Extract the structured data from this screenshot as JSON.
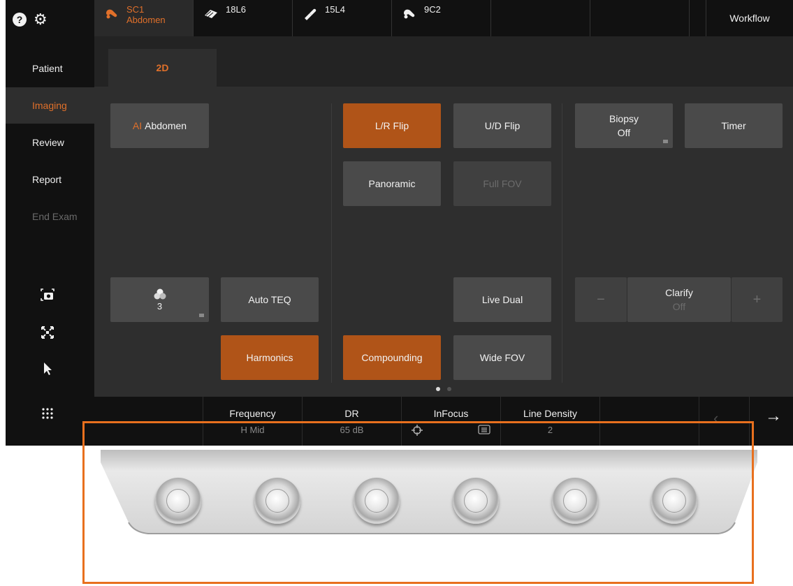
{
  "sidebar": {
    "help_icon": "question-circle-icon",
    "settings_icon": "gear-icon",
    "items": [
      {
        "label": "Patient"
      },
      {
        "label": "Imaging"
      },
      {
        "label": "Review"
      },
      {
        "label": "Report"
      },
      {
        "label": "End Exam"
      }
    ],
    "active_item": "Imaging",
    "tools": [
      "camera-icon",
      "fit-screen-icon",
      "pointer-arrow-icon",
      "grid-menu-icon"
    ]
  },
  "topbar": {
    "probes": [
      {
        "line1": "SC1",
        "line2": "Abdomen"
      },
      {
        "line1": "18L6",
        "line2": ""
      },
      {
        "line1": "15L4",
        "line2": ""
      },
      {
        "line1": "9C2",
        "line2": ""
      }
    ],
    "active_probe": "SC1",
    "workflow_label": "Workflow"
  },
  "tabs": {
    "active": "2D"
  },
  "controls": {
    "ai_prefix": "AI",
    "ai_abdomen": "Abdomen",
    "lr_flip": "L/R Flip",
    "ud_flip": "U/D Flip",
    "biopsy_line1": "Biopsy",
    "biopsy_line2": "Off",
    "timer": "Timer",
    "panoramic": "Panoramic",
    "full_fov": "Full FOV",
    "map_value": "3",
    "auto_teq": "Auto TEQ",
    "live_dual": "Live Dual",
    "clarify_line1": "Clarify",
    "clarify_line2": "Off",
    "minus": "−",
    "plus": "+",
    "harmonics": "Harmonics",
    "compounding": "Compounding",
    "wide_fov": "Wide FOV"
  },
  "states": {
    "lr_flip": "on",
    "harmonics": "on",
    "compounding": "on",
    "full_fov": "disabled",
    "clarify": "disabled"
  },
  "pagination": {
    "pages": 2,
    "current": 1
  },
  "params": [
    {
      "label": "Frequency",
      "value": "H Mid"
    },
    {
      "label": "DR",
      "value": "65 dB"
    },
    {
      "label": "InFocus",
      "value": ""
    },
    {
      "label": "Line Density",
      "value": "2"
    }
  ],
  "colors": {
    "accent": "#e0702a",
    "button_on": "#b05418",
    "highlight": "#e8701e"
  },
  "hardware": {
    "knob_count": 6
  }
}
